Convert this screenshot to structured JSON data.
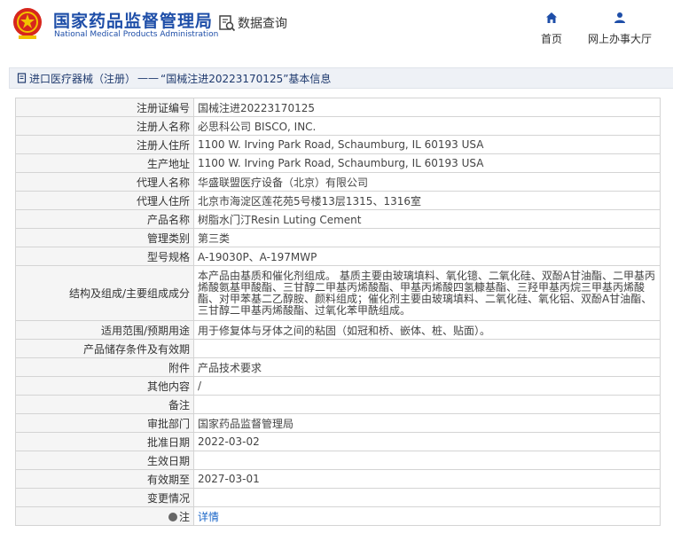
{
  "header": {
    "brand_cn": "国家药品监督管理局",
    "brand_en": "National Medical Products Administration",
    "search_label": "数据查询",
    "nav_home": "首页",
    "nav_office": "网上办事大厅",
    "brand_color": "#1e4ea8",
    "emblem_color": "#d7261d"
  },
  "title_bar": {
    "section": "进口医疗器械（注册）",
    "separator": "——",
    "record_title": "“国械注进20223170125”基本信息"
  },
  "rows": [
    {
      "label": "注册证编号",
      "value": "国械注进20223170125"
    },
    {
      "label": "注册人名称",
      "value": "必思科公司 BISCO, INC."
    },
    {
      "label": "注册人住所",
      "value": "1100 W. Irving Park Road, Schaumburg, IL 60193 USA"
    },
    {
      "label": "生产地址",
      "value": "1100 W. Irving Park Road, Schaumburg, IL 60193 USA"
    },
    {
      "label": "代理人名称",
      "value": "华盛联盟医疗设备（北京）有限公司"
    },
    {
      "label": "代理人住所",
      "value": "北京市海淀区莲花苑5号楼13层1315、1316室"
    },
    {
      "label": "产品名称",
      "value": "树脂水门汀Resin Luting Cement"
    },
    {
      "label": "管理类别",
      "value": "第三类"
    },
    {
      "label": "型号规格",
      "value": "A-19030P、A-197MWP"
    },
    {
      "label": "结构及组成/主要组成成分",
      "value": "本产品由基质和催化剂组成。 基质主要由玻璃填料、氧化镱、二氧化硅、双酚A甘油酯、二甲基丙烯酸氨基甲酸酯、三甘醇二甲基丙烯酸酯、甲基丙烯酸四氢糠基酯、三羟甲基丙烷三甲基丙烯酸酯、对甲苯基二乙醇胺、颜料组成；催化剂主要由玻璃填料、二氧化硅、氧化铝、双酚A甘油酯、三甘醇二甲基丙烯酸酯、过氧化苯甲酰组成。"
    },
    {
      "label": "适用范围/预期用途",
      "value": "用于修复体与牙体之间的粘固（如冠和桥、嵌体、桩、贴面）。"
    },
    {
      "label": "产品储存条件及有效期",
      "value": ""
    },
    {
      "label": "附件",
      "value": "产品技术要求"
    },
    {
      "label": "其他内容",
      "value": "/"
    },
    {
      "label": "备注",
      "value": ""
    },
    {
      "label": "审批部门",
      "value": "国家药品监督管理局"
    },
    {
      "label": "批准日期",
      "value": "2022-03-02"
    },
    {
      "label": "生效日期",
      "value": ""
    },
    {
      "label": "有效期至",
      "value": "2027-03-01"
    },
    {
      "label": "变更情况",
      "value": ""
    }
  ],
  "note_row": {
    "label": "注",
    "link": "详情"
  }
}
